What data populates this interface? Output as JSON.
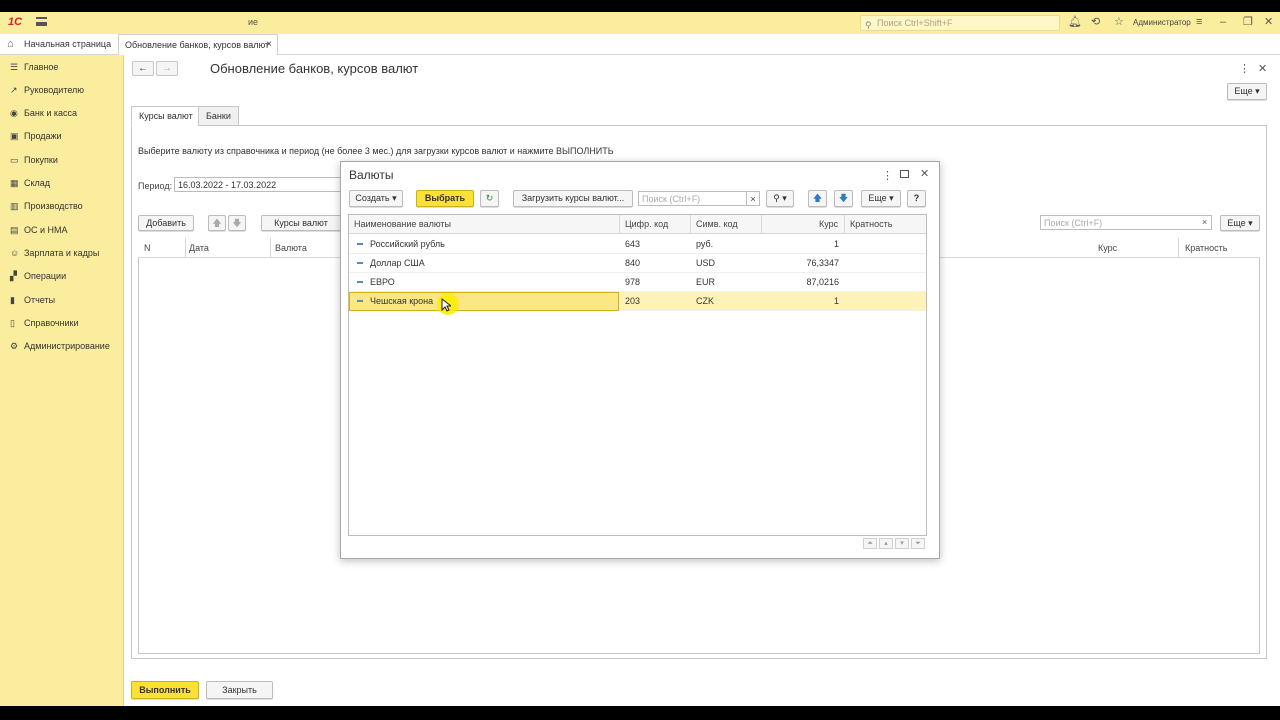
{
  "topbar": {
    "title_fragment": "ие",
    "search_placeholder": "Поиск Ctrl+Shift+F",
    "user": "Администратор"
  },
  "tabs": {
    "home": "Начальная страница",
    "active": "Обновление банков, курсов валют"
  },
  "sidebar": {
    "items": [
      {
        "label": "Главное",
        "icon": "menu-icon"
      },
      {
        "label": "Руководителю",
        "icon": "trend-icon"
      },
      {
        "label": "Банк и касса",
        "icon": "bank-icon"
      },
      {
        "label": "Продажи",
        "icon": "sales-icon"
      },
      {
        "label": "Покупки",
        "icon": "cart-icon"
      },
      {
        "label": "Склад",
        "icon": "warehouse-icon"
      },
      {
        "label": "Производство",
        "icon": "factory-icon"
      },
      {
        "label": "ОС и НМА",
        "icon": "assets-icon"
      },
      {
        "label": "Зарплата и кадры",
        "icon": "people-icon"
      },
      {
        "label": "Операции",
        "icon": "operations-icon"
      },
      {
        "label": "Отчеты",
        "icon": "reports-icon"
      },
      {
        "label": "Справочники",
        "icon": "book-icon"
      },
      {
        "label": "Администрирование",
        "icon": "gear-icon"
      }
    ]
  },
  "form": {
    "title": "Обновление банков, курсов валют",
    "more": "Еще",
    "tab_rates": "Курсы валют",
    "tab_banks": "Банки",
    "hint": "Выберите валюту из справочника и период (не более 3 мес.) для загрузки курсов валют и нажмите ВЫПОЛНИТЬ",
    "period_label": "Период:",
    "period_value": "16.03.2022 - 17.03.2022",
    "add_button": "Добавить",
    "rates_button": "Курсы валют",
    "search_placeholder": "Поиск (Ctrl+F)",
    "more2": "Еще",
    "columns": {
      "n": "N",
      "date": "Дата",
      "currency": "Валюта",
      "rate": "Курс",
      "multiplicity": "Кратность"
    },
    "execute_button": "Выполнить",
    "close_button": "Закрыть"
  },
  "modal": {
    "title": "Валюты",
    "create_button": "Создать",
    "select_button": "Выбрать",
    "load_button": "Загрузить курсы валют...",
    "search_placeholder": "Поиск (Ctrl+F)",
    "more": "Еще",
    "help": "?",
    "columns": {
      "name": "Наименование валюты",
      "numcode": "Цифр. код",
      "symcode": "Симв. код",
      "rate": "Курс",
      "multiplicity": "Кратность"
    },
    "rows": [
      {
        "name": "Российский рубль",
        "numcode": "643",
        "symcode": "руб.",
        "rate": "1"
      },
      {
        "name": "Доллар США",
        "numcode": "840",
        "symcode": "USD",
        "rate": "76,3347"
      },
      {
        "name": "ЕВРО",
        "numcode": "978",
        "symcode": "EUR",
        "rate": "87,0216"
      },
      {
        "name": "Чешская крона",
        "numcode": "203",
        "symcode": "CZK",
        "rate": "1"
      }
    ]
  }
}
